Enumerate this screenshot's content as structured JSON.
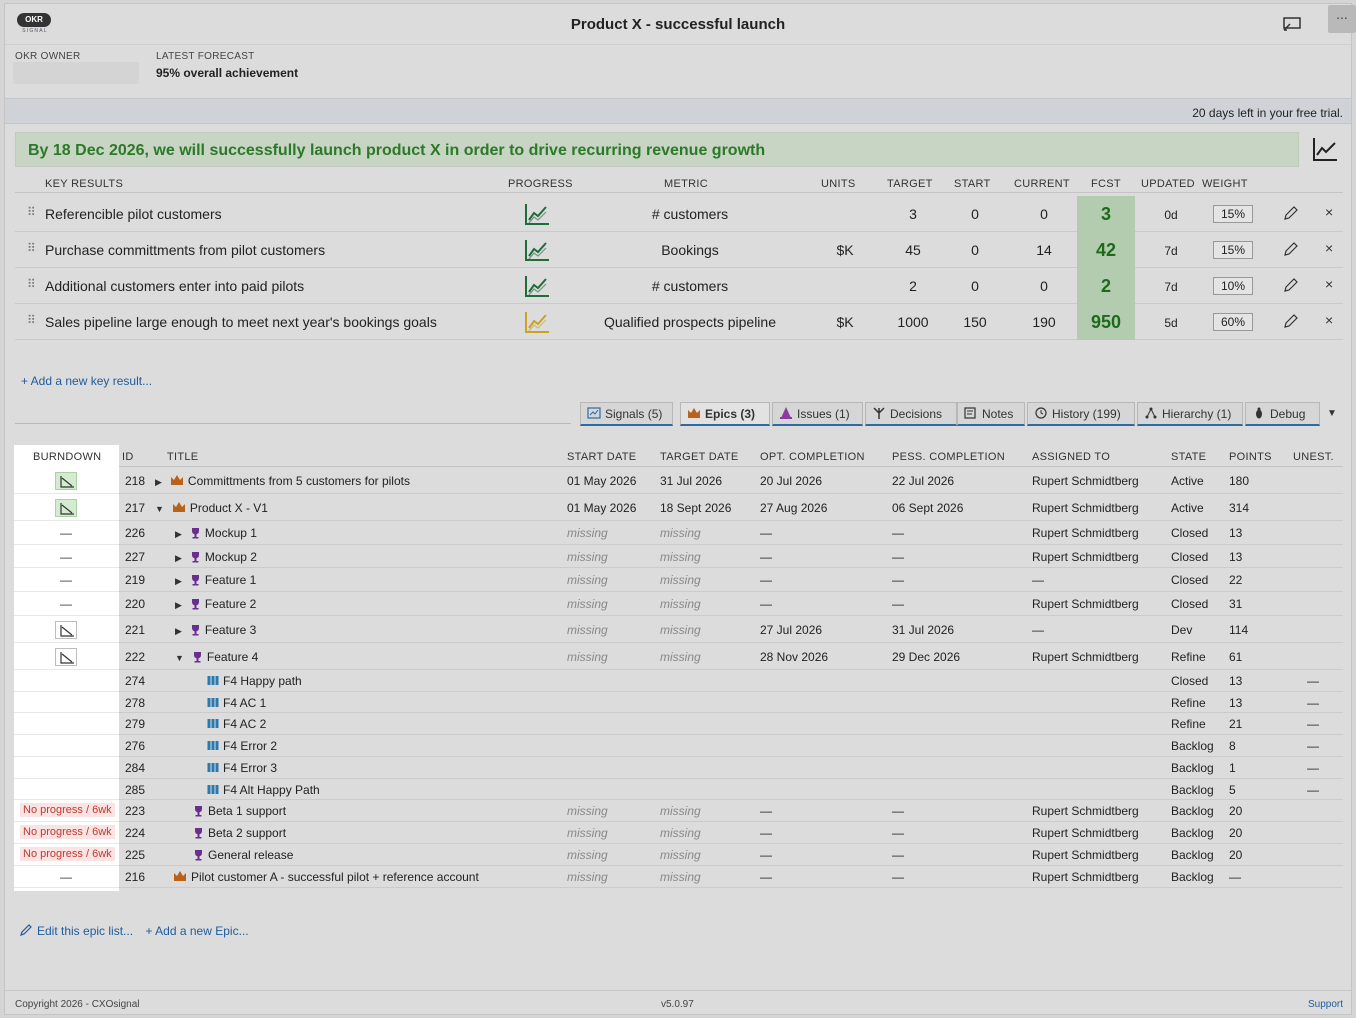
{
  "app": {
    "logo_text": "OKR",
    "logo_sub": "SIGNAL",
    "title": "Product X - successful launch",
    "more_label": "..."
  },
  "owner": {
    "label": "OKR OWNER",
    "value": ""
  },
  "forecast": {
    "label": "LATEST FORECAST",
    "value": "95% overall achievement"
  },
  "trial": {
    "text": "20 days left in your free trial."
  },
  "objective": {
    "text": "By 18 Dec 2026, we will successfully launch product X in order to drive recurring revenue growth",
    "color": "#2b7a27"
  },
  "kr_headers": {
    "key_results": "KEY RESULTS",
    "progress": "PROGRESS",
    "metric": "METRIC",
    "units": "UNITS",
    "target": "TARGET",
    "start": "START",
    "current": "CURRENT",
    "fcst": "FCST",
    "updated": "UPDATED",
    "weight": "WEIGHT"
  },
  "key_results": [
    {
      "title": "Referencible pilot customers",
      "progress_color": "#1f6b3a",
      "metric": "# customers",
      "units": "",
      "target": "3",
      "start": "0",
      "current": "0",
      "fcst": "3",
      "updated": "0d",
      "weight": "15%"
    },
    {
      "title": "Purchase committments from pilot customers",
      "progress_color": "#1f6b3a",
      "metric": "Bookings",
      "units": "$K",
      "target": "45",
      "start": "0",
      "current": "14",
      "fcst": "42",
      "updated": "7d",
      "weight": "15%"
    },
    {
      "title": "Additional customers enter into paid pilots",
      "progress_color": "#1f6b3a",
      "metric": "# customers",
      "units": "",
      "target": "2",
      "start": "0",
      "current": "0",
      "fcst": "2",
      "updated": "7d",
      "weight": "10%"
    },
    {
      "title": "Sales pipeline large enough to meet next year's bookings goals",
      "progress_color": "#c9a227",
      "metric": "Qualified prospects pipeline",
      "units": "$K",
      "target": "1000",
      "start": "150",
      "current": "190",
      "fcst": "950",
      "updated": "5d",
      "weight": "60%"
    }
  ],
  "add_kr": "+ Add a new key result...",
  "tabs": [
    {
      "label": "Signals (5)",
      "icon": "signals-icon"
    },
    {
      "label": "Epics (3)",
      "icon": "crown-icon",
      "active": true
    },
    {
      "label": "Issues (1)",
      "icon": "cone-icon"
    },
    {
      "label": "Decisions",
      "icon": "decision-icon"
    },
    {
      "label": "Notes",
      "icon": "notes-icon"
    },
    {
      "label": "History (199)",
      "icon": "history-icon"
    },
    {
      "label": "Hierarchy (1)",
      "icon": "hierarchy-icon"
    },
    {
      "label": "Debug",
      "icon": "debug-icon"
    }
  ],
  "epic_headers": {
    "burndown": "BURNDOWN",
    "id": "ID",
    "title": "TITLE",
    "start_date": "START DATE",
    "target_date": "TARGET DATE",
    "opt": "OPT. COMPLETION",
    "pess": "PESS. COMPLETION",
    "assigned": "ASSIGNED TO",
    "state": "STATE",
    "points": "POINTS",
    "unest": "UNEST."
  },
  "epics": [
    {
      "burn": "chart-green",
      "id": "218",
      "title": "Committments from 5 customers for pilots",
      "type": "crown",
      "toggle": "right",
      "indent": 0,
      "start": "01 May 2026",
      "target": "31 Jul 2026",
      "opt": "20 Jul 2026",
      "pess": "22 Jul 2026",
      "assigned": "Rupert Schmidtberg",
      "state": "Active",
      "points": "180",
      "unest": ""
    },
    {
      "burn": "chart-green",
      "id": "217",
      "title": "Product X - V1",
      "type": "crown",
      "toggle": "down",
      "indent": 0,
      "start": "01 May 2026",
      "target": "18 Sept 2026",
      "opt": "27 Aug 2026",
      "pess": "06 Sept 2026",
      "assigned": "Rupert Schmidtberg",
      "state": "Active",
      "points": "314",
      "unest": ""
    },
    {
      "burn": "dash",
      "id": "226",
      "title": "Mockup 1",
      "type": "trophy",
      "toggle": "right",
      "indent": 1,
      "start": "missing",
      "target": "missing",
      "opt": "—",
      "pess": "—",
      "assigned": "Rupert Schmidtberg",
      "state": "Closed",
      "points": "13",
      "unest": ""
    },
    {
      "burn": "dash",
      "id": "227",
      "title": "Mockup 2",
      "type": "trophy",
      "toggle": "right",
      "indent": 1,
      "start": "missing",
      "target": "missing",
      "opt": "—",
      "pess": "—",
      "assigned": "Rupert Schmidtberg",
      "state": "Closed",
      "points": "13",
      "unest": ""
    },
    {
      "burn": "dash",
      "id": "219",
      "title": "Feature 1",
      "type": "trophy",
      "toggle": "right",
      "indent": 1,
      "start": "missing",
      "target": "missing",
      "opt": "—",
      "pess": "—",
      "assigned": "—",
      "state": "Closed",
      "points": "22",
      "unest": ""
    },
    {
      "burn": "dash",
      "id": "220",
      "title": "Feature 2",
      "type": "trophy",
      "toggle": "right",
      "indent": 1,
      "start": "missing",
      "target": "missing",
      "opt": "—",
      "pess": "—",
      "assigned": "Rupert Schmidtberg",
      "state": "Closed",
      "points": "31",
      "unest": ""
    },
    {
      "burn": "chart",
      "id": "221",
      "title": "Feature 3",
      "type": "trophy",
      "toggle": "right",
      "indent": 1,
      "start": "missing",
      "target": "missing",
      "opt": "27 Jul 2026",
      "pess": "31 Jul 2026",
      "assigned": "—",
      "state": "Dev",
      "points": "114",
      "unest": ""
    },
    {
      "burn": "chart",
      "id": "222",
      "title": "Feature 4",
      "type": "trophy",
      "toggle": "down",
      "indent": 1,
      "start": "missing",
      "target": "missing",
      "opt": "28 Nov 2026",
      "pess": "29 Dec 2026",
      "assigned": "Rupert Schmidtberg",
      "state": "Refine",
      "points": "61",
      "unest": ""
    },
    {
      "burn": "",
      "id": "274",
      "title": "F4 Happy path",
      "type": "book",
      "toggle": "",
      "indent": 2,
      "start": "",
      "target": "",
      "opt": "",
      "pess": "",
      "assigned": "",
      "state": "Closed",
      "points": "13",
      "unest": "—"
    },
    {
      "burn": "",
      "id": "278",
      "title": "F4 AC 1",
      "type": "book",
      "toggle": "",
      "indent": 2,
      "start": "",
      "target": "",
      "opt": "",
      "pess": "",
      "assigned": "",
      "state": "Refine",
      "points": "13",
      "unest": "—"
    },
    {
      "burn": "",
      "id": "279",
      "title": "F4 AC 2",
      "type": "book",
      "toggle": "",
      "indent": 2,
      "start": "",
      "target": "",
      "opt": "",
      "pess": "",
      "assigned": "",
      "state": "Refine",
      "points": "21",
      "unest": "—"
    },
    {
      "burn": "",
      "id": "276",
      "title": "F4 Error 2",
      "type": "book",
      "toggle": "",
      "indent": 2,
      "start": "",
      "target": "",
      "opt": "",
      "pess": "",
      "assigned": "",
      "state": "Backlog",
      "points": "8",
      "unest": "—"
    },
    {
      "burn": "",
      "id": "284",
      "title": "F4 Error 3",
      "type": "book",
      "toggle": "",
      "indent": 2,
      "start": "",
      "target": "",
      "opt": "",
      "pess": "",
      "assigned": "",
      "state": "Backlog",
      "points": "1",
      "unest": "—"
    },
    {
      "burn": "",
      "id": "285",
      "title": "F4 Alt Happy Path",
      "type": "book",
      "toggle": "",
      "indent": 2,
      "start": "",
      "target": "",
      "opt": "",
      "pess": "",
      "assigned": "",
      "state": "Backlog",
      "points": "5",
      "unest": "—"
    },
    {
      "burn": "No progress / 6wk",
      "id": "223",
      "title": "Beta 1 support",
      "type": "trophy",
      "toggle": "",
      "indent": 1,
      "start": "missing",
      "target": "missing",
      "opt": "—",
      "pess": "—",
      "assigned": "Rupert Schmidtberg",
      "state": "Backlog",
      "points": "20",
      "unest": ""
    },
    {
      "burn": "No progress / 6wk",
      "id": "224",
      "title": "Beta 2 support",
      "type": "trophy",
      "toggle": "",
      "indent": 1,
      "start": "missing",
      "target": "missing",
      "opt": "—",
      "pess": "—",
      "assigned": "Rupert Schmidtberg",
      "state": "Backlog",
      "points": "20",
      "unest": ""
    },
    {
      "burn": "No progress / 6wk",
      "id": "225",
      "title": "General release",
      "type": "trophy",
      "toggle": "",
      "indent": 1,
      "start": "missing",
      "target": "missing",
      "opt": "—",
      "pess": "—",
      "assigned": "Rupert Schmidtberg",
      "state": "Backlog",
      "points": "20",
      "unest": ""
    },
    {
      "burn": "dash",
      "id": "216",
      "title": "Pilot customer A - successful pilot + reference account",
      "type": "crown",
      "toggle": "",
      "indent": 0,
      "start": "missing",
      "target": "missing",
      "opt": "—",
      "pess": "—",
      "assigned": "Rupert Schmidtberg",
      "state": "Backlog",
      "points": "—",
      "unest": ""
    }
  ],
  "edit_epics": "Edit this epic list...",
  "add_epic": "+ Add a new Epic...",
  "footer": {
    "copyright": "Copyright 2026 - CXOsignal",
    "version": "v5.0.97",
    "support": "Support"
  }
}
